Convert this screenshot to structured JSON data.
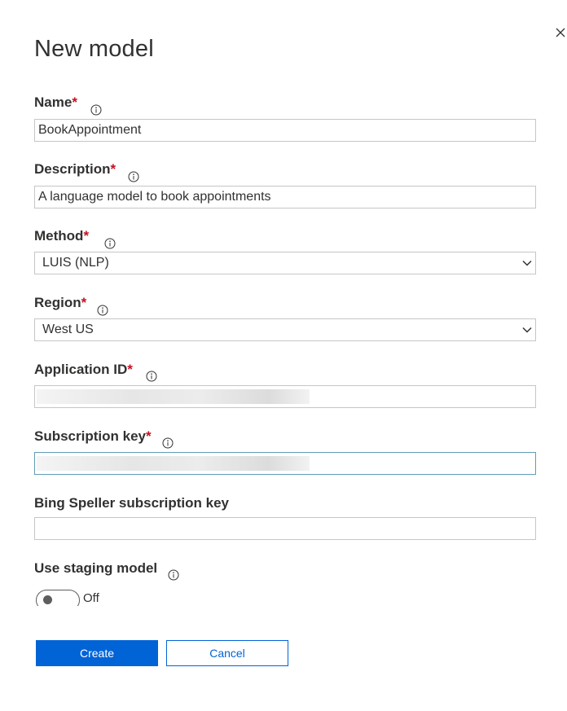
{
  "dialog": {
    "title": "New model",
    "close_icon": "close-icon"
  },
  "fields": {
    "name": {
      "label": "Name",
      "required": "*",
      "value": "BookAppointment"
    },
    "description": {
      "label": "Description",
      "required": "*",
      "value": "A language model to book appointments"
    },
    "method": {
      "label": "Method",
      "required": "*",
      "selected": "LUIS (NLP)"
    },
    "region": {
      "label": "Region",
      "required": "*",
      "selected": "West US"
    },
    "application_id": {
      "label": "Application ID",
      "required": "*",
      "value": ""
    },
    "subscription_key": {
      "label": "Subscription key",
      "required": "*",
      "value": ""
    },
    "bing_key": {
      "label": "Bing Speller subscription key",
      "value": ""
    },
    "staging": {
      "label": "Use staging model",
      "toggle_state": "Off"
    }
  },
  "buttons": {
    "create": "Create",
    "cancel": "Cancel"
  },
  "colors": {
    "primary": "#0063d6",
    "required": "#c50f1f",
    "focus_border": "#5e9eb5"
  }
}
